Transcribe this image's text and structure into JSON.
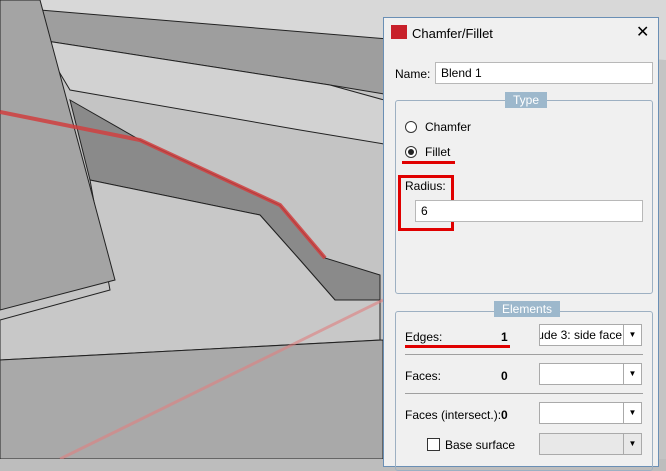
{
  "dialog": {
    "title": "Chamfer/Fillet",
    "name_label": "Name:",
    "name_value": "Blend 1",
    "type_legend": "Type",
    "chamfer_label": "Chamfer",
    "fillet_label": "Fillet",
    "selected_type": "Fillet",
    "radius_label": "Radius:",
    "radius_value": "6",
    "elements_legend": "Elements",
    "edges_label": "Edges:",
    "edges_count": "1",
    "edges_combo": "ude 3: side face",
    "faces_label": "Faces:",
    "faces_count": "0",
    "faces_intersect_label": "Faces (intersect.):",
    "faces_intersect_count": "0",
    "base_surface_label": "Base surface",
    "highlight_color": "#e00000"
  }
}
